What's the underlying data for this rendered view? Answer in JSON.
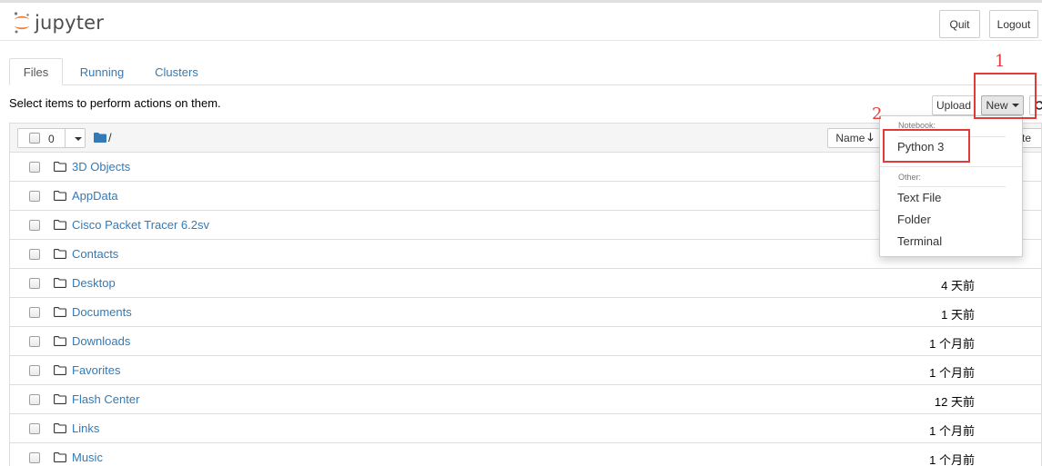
{
  "header": {
    "logo_text": "jupyter",
    "quit_label": "Quit",
    "logout_label": "Logout"
  },
  "tabs": [
    {
      "label": "Files",
      "active": true
    },
    {
      "label": "Running",
      "active": false
    },
    {
      "label": "Clusters",
      "active": false
    }
  ],
  "toolbar": {
    "select_text": "Select items to perform actions on them.",
    "upload_label": "Upload",
    "new_label": "New"
  },
  "list": {
    "selected_count": "0",
    "breadcrumb": "/",
    "sort_label": "Name",
    "sort_arrow": "🡓",
    "last_modified_partial": "te",
    "rows": [
      {
        "name": "3D Objects",
        "date": ""
      },
      {
        "name": "AppData",
        "date": ""
      },
      {
        "name": "Cisco Packet Tracer 6.2sv",
        "date": ""
      },
      {
        "name": "Contacts",
        "date": ""
      },
      {
        "name": "Desktop",
        "date": "4 天前"
      },
      {
        "name": "Documents",
        "date": "1 天前"
      },
      {
        "name": "Downloads",
        "date": "1 个月前"
      },
      {
        "name": "Favorites",
        "date": "1 个月前"
      },
      {
        "name": "Flash Center",
        "date": "12 天前"
      },
      {
        "name": "Links",
        "date": "1 个月前"
      },
      {
        "name": "Music",
        "date": "1 个月前"
      }
    ]
  },
  "new_menu": {
    "notebook_header": "Notebook:",
    "python_label": "Python 3",
    "other_header": "Other:",
    "text_file_label": "Text File",
    "folder_label": "Folder",
    "terminal_label": "Terminal"
  },
  "annotations": {
    "step1": "1",
    "step2": "2",
    "color": "#e03a3a"
  },
  "colors": {
    "link": "#337ab7",
    "logo_orange": "#f37726",
    "logo_gray": "#767677"
  }
}
